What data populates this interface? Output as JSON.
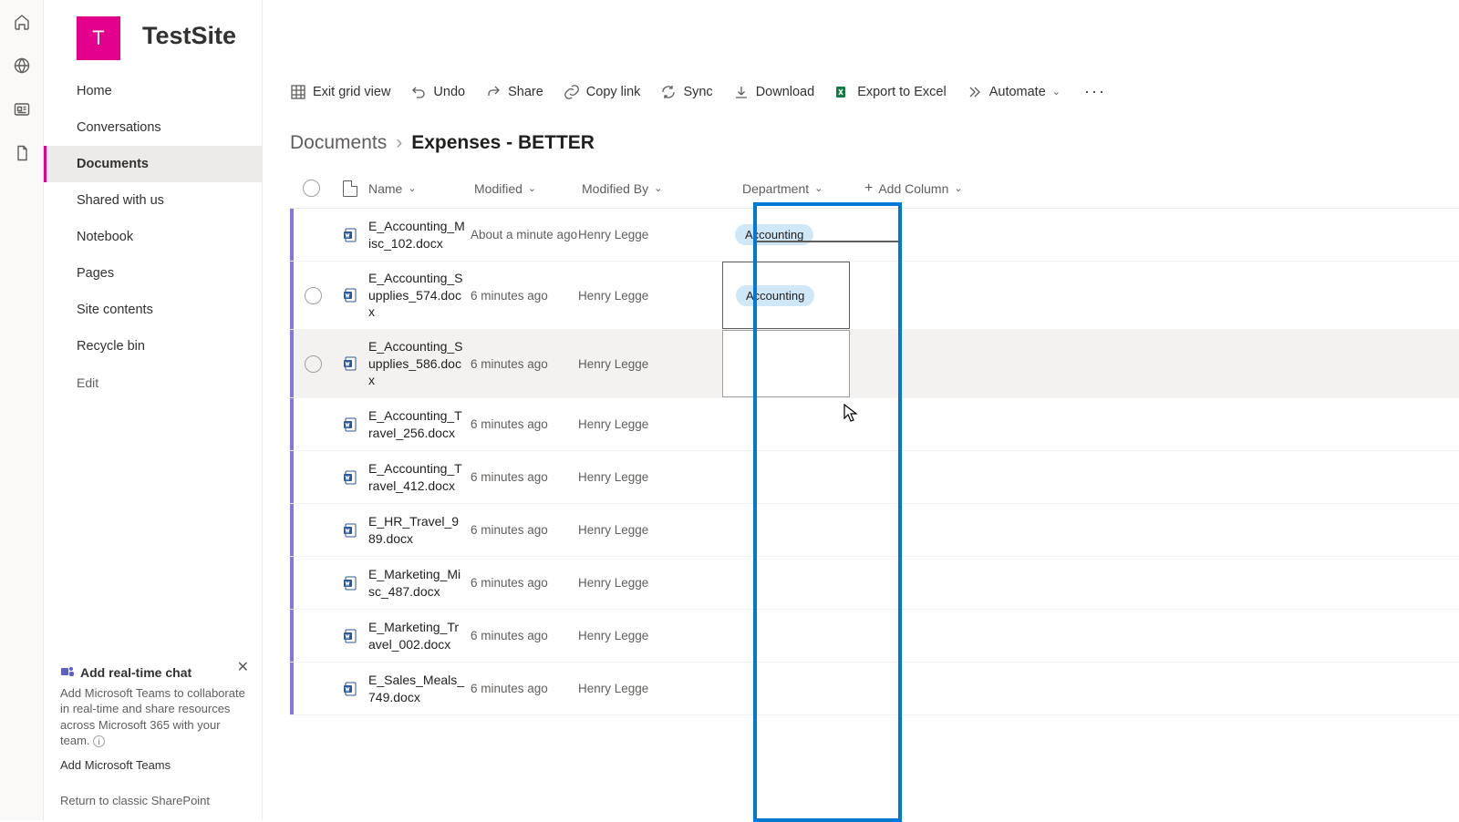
{
  "site": {
    "tile_letter": "T",
    "title": "TestSite"
  },
  "rail": [
    "home-icon",
    "globe-icon",
    "news-icon",
    "files-icon"
  ],
  "sidebar": {
    "items": [
      {
        "label": "Home"
      },
      {
        "label": "Conversations"
      },
      {
        "label": "Documents",
        "active": true
      },
      {
        "label": "Shared with us"
      },
      {
        "label": "Notebook"
      },
      {
        "label": "Pages"
      },
      {
        "label": "Site contents"
      },
      {
        "label": "Recycle bin"
      }
    ],
    "edit_label": "Edit"
  },
  "chat_promo": {
    "title": "Add real-time chat",
    "body": "Add Microsoft Teams to collaborate in real-time and share resources across Microsoft 365 with your team.",
    "link": "Add Microsoft Teams"
  },
  "classic_link": "Return to classic SharePoint",
  "toolbar": {
    "exit_grid": "Exit grid view",
    "undo": "Undo",
    "share": "Share",
    "copy_link": "Copy link",
    "sync": "Sync",
    "download": "Download",
    "export": "Export to Excel",
    "automate": "Automate"
  },
  "breadcrumb": {
    "root": "Documents",
    "current": "Expenses - BETTER"
  },
  "columns": {
    "name": "Name",
    "modified": "Modified",
    "modified_by": "Modified By",
    "department": "Department",
    "add_column": "Add Column"
  },
  "rows": [
    {
      "name": "E_Accounting_Misc_102.docx",
      "modified": "About a minute ago",
      "by": "Henry Legge",
      "dept": "Accounting",
      "show_sel": false
    },
    {
      "name": "E_Accounting_Supplies_574.docx",
      "modified": "6 minutes ago",
      "by": "Henry Legge",
      "dept": "Accounting",
      "show_sel": true,
      "dept_boxed": true
    },
    {
      "name": "E_Accounting_Supplies_586.docx",
      "modified": "6 minutes ago",
      "by": "Henry Legge",
      "dept": "",
      "show_sel": true,
      "hover": true,
      "dept_boxed": true,
      "dept_empty": true
    },
    {
      "name": "E_Accounting_Travel_256.docx",
      "modified": "6 minutes ago",
      "by": "Henry Legge",
      "dept": "",
      "show_sel": false
    },
    {
      "name": "E_Accounting_Travel_412.docx",
      "modified": "6 minutes ago",
      "by": "Henry Legge",
      "dept": "",
      "show_sel": false
    },
    {
      "name": "E_HR_Travel_989.docx",
      "modified": "6 minutes ago",
      "by": "Henry Legge",
      "dept": "",
      "show_sel": false
    },
    {
      "name": "E_Marketing_Misc_487.docx",
      "modified": "6 minutes ago",
      "by": "Henry Legge",
      "dept": "",
      "show_sel": false
    },
    {
      "name": "E_Marketing_Travel_002.docx",
      "modified": "6 minutes ago",
      "by": "Henry Legge",
      "dept": "",
      "show_sel": false
    },
    {
      "name": "E_Sales_Meals_749.docx",
      "modified": "6 minutes ago",
      "by": "Henry Legge",
      "dept": "",
      "show_sel": false
    }
  ]
}
